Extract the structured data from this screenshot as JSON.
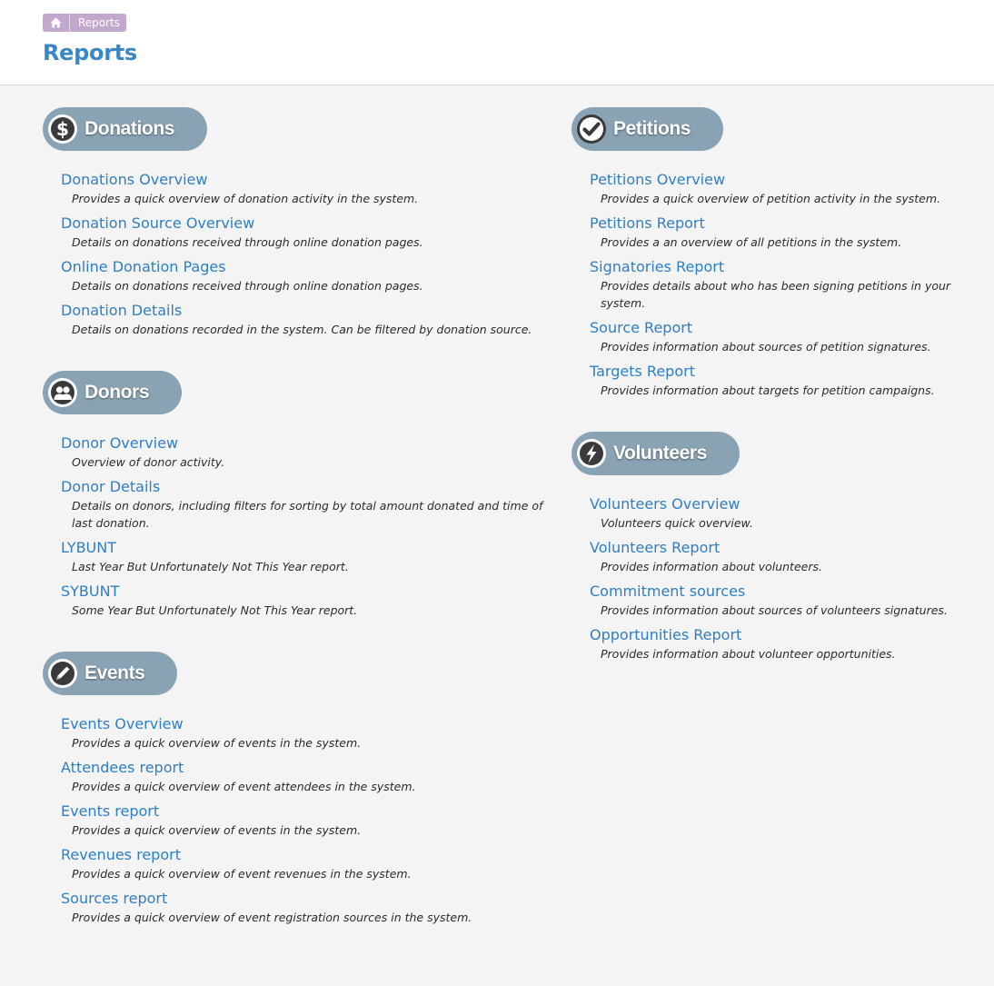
{
  "breadcrumb": {
    "home_icon": "home-icon",
    "current": "Reports"
  },
  "page_title": "Reports",
  "colors": {
    "title": "#3a87c7",
    "link": "#2f7fc5",
    "section_pill": "#8aa3b4",
    "breadcrumb_bg": "#c2a8cc"
  },
  "left_sections": [
    {
      "title": "Donations",
      "icon": "dollar-icon",
      "items": [
        {
          "label": "Donations Overview",
          "desc": "Provides a quick overview of donation activity in the system."
        },
        {
          "label": "Donation Source Overview",
          "desc": "Details on donations received through online donation pages."
        },
        {
          "label": "Online Donation Pages",
          "desc": "Details on donations received through online donation pages."
        },
        {
          "label": "Donation Details",
          "desc": "Details on donations recorded in the system. Can be filtered by donation source."
        }
      ]
    },
    {
      "title": "Donors",
      "icon": "users-icon",
      "items": [
        {
          "label": "Donor Overview",
          "desc": "Overview of donor activity."
        },
        {
          "label": "Donor Details",
          "desc": "Details on donors, including filters for sorting by total amount donated and time of last donation."
        },
        {
          "label": "LYBUNT",
          "desc": "Last Year But Unfortunately Not This Year report."
        },
        {
          "label": "SYBUNT",
          "desc": "Some Year But Unfortunately Not This Year report."
        }
      ]
    },
    {
      "title": "Events",
      "icon": "pencil-icon",
      "items": [
        {
          "label": "Events Overview",
          "desc": "Provides a quick overview of events in the system."
        },
        {
          "label": "Attendees report",
          "desc": "Provides a quick overview of event attendees in the system."
        },
        {
          "label": "Events report",
          "desc": "Provides a quick overview of events in the system."
        },
        {
          "label": "Revenues report",
          "desc": "Provides a quick overview of event revenues in the system."
        },
        {
          "label": "Sources report",
          "desc": "Provides a quick overview of event registration sources in the system."
        }
      ]
    }
  ],
  "right_sections": [
    {
      "title": "Petitions",
      "icon": "checkmark-icon",
      "items": [
        {
          "label": "Petitions Overview",
          "desc": "Provides a quick overview of petition activity in the system."
        },
        {
          "label": "Petitions Report",
          "desc": "Provides a an overview of all petitions in the system."
        },
        {
          "label": "Signatories Report",
          "desc": "Provides details about who has been signing petitions in your system."
        },
        {
          "label": "Source Report",
          "desc": "Provides information about sources of petition signatures."
        },
        {
          "label": "Targets Report",
          "desc": "Provides information about targets for petition campaigns."
        }
      ]
    },
    {
      "title": "Volunteers",
      "icon": "lightning-icon",
      "items": [
        {
          "label": "Volunteers Overview",
          "desc": "Volunteers quick overview."
        },
        {
          "label": "Volunteers Report",
          "desc": "Provides information about volunteers."
        },
        {
          "label": "Commitment sources",
          "desc": "Provides information about sources of volunteers signatures."
        },
        {
          "label": "Opportunities Report",
          "desc": "Provides information about volunteer opportunities."
        }
      ]
    }
  ]
}
